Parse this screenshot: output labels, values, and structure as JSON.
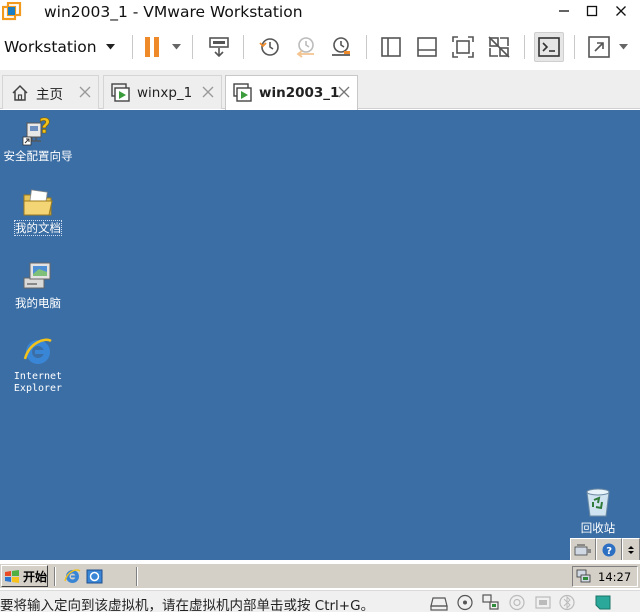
{
  "window": {
    "title": "win2003_1 - VMware Workstation",
    "app_icon": "vmware-logo-icon",
    "controls": [
      "minimize-icon",
      "maximize-icon",
      "close-icon"
    ]
  },
  "toolbar": {
    "workstation_menu_label": "Workstation",
    "buttons": [
      "pause-icon",
      "send-ctrl-alt-del-icon",
      "snapshot-take-icon",
      "snapshot-revert-icon",
      "snapshot-manager-icon",
      "show-library-icon",
      "thumbnail-bar-icon",
      "full-screen-fit-icon",
      "unity-disabled-icon",
      "console-view-icon",
      "enter-fullscreen-icon"
    ]
  },
  "tabs": [
    {
      "label": "主页",
      "icon": "home-icon",
      "active": false
    },
    {
      "label": "winxp_1",
      "icon": "vm-icon",
      "active": false
    },
    {
      "label": "win2003_1",
      "icon": "vm-icon",
      "active": true
    }
  ],
  "desktop": {
    "background_color": "#3b6ea5",
    "icons": [
      {
        "label": "安全配置向导",
        "icon": "security-wizard-icon"
      },
      {
        "label": "我的文档",
        "icon": "my-documents-folder-icon"
      },
      {
        "label": "我的电脑",
        "icon": "my-computer-icon"
      },
      {
        "label": "Internet\nExplorer",
        "icon": "internet-explorer-icon"
      },
      {
        "label": "回收站",
        "icon": "recycle-bin-icon"
      }
    ]
  },
  "vm_tools": [
    "network-adapter-icon",
    "help-icon",
    "scroll-down-icon"
  ],
  "taskbar": {
    "start_label": "开始",
    "quick_launch": [
      "internet-explorer-icon",
      "show-desktop-icon"
    ],
    "tray_icon": "network-tray-icon",
    "clock": "14:27"
  },
  "statusbar": {
    "message": "要将输入定向到该虚拟机，请在虚拟机内部单击或按 Ctrl+G。",
    "device_icons": [
      "hard-disk-icon",
      "cd-dvd-icon",
      "network-icon",
      "sound-icon",
      "usb-icon",
      "bluetooth-icon",
      "printer-icon",
      "message-icon"
    ]
  }
}
